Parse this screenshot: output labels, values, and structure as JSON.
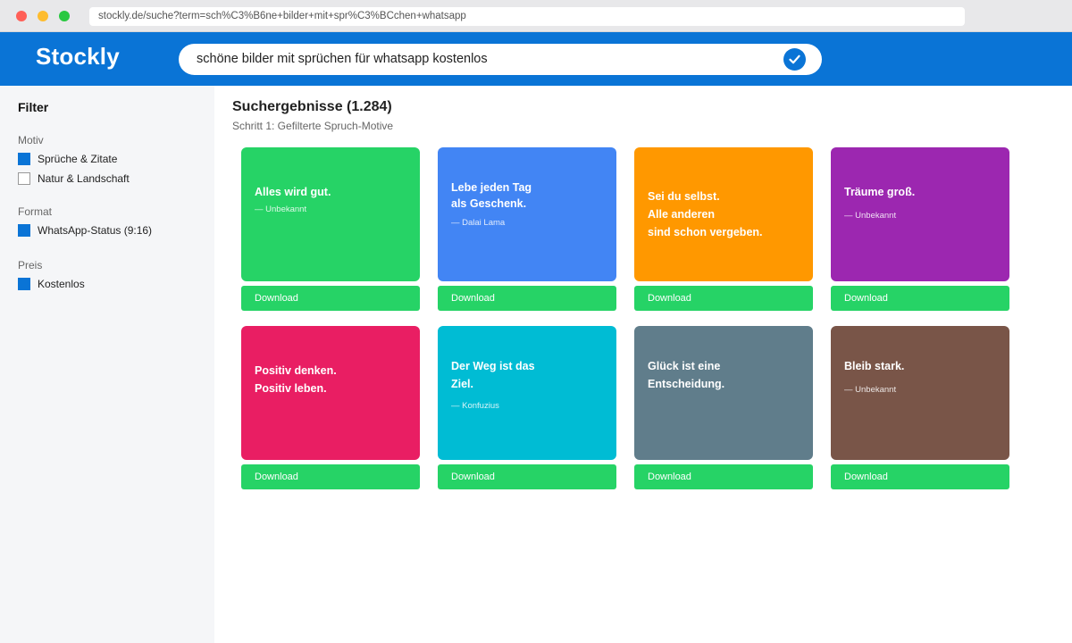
{
  "browser": {
    "url": "stockly.de/suche?term=sch%C3%B6ne+bilder+mit+spr%C3%BCchen+whatsapp"
  },
  "header": {
    "logo": "Stockly",
    "search_value": "schöne bilder mit sprüchen für whatsapp kostenlos",
    "search_icon": "check-circle-icon"
  },
  "sidebar": {
    "title": "Filter",
    "groups": [
      {
        "label": "Motiv",
        "options": [
          {
            "label": "Sprüche & Zitate",
            "checked": true
          },
          {
            "label": "Natur & Landschaft",
            "checked": false
          }
        ]
      },
      {
        "label": "Format",
        "options": [
          {
            "label": "WhatsApp-Status (9:16)",
            "checked": true
          }
        ]
      },
      {
        "label": "Preis",
        "options": [
          {
            "label": "Kostenlos",
            "checked": true
          }
        ]
      }
    ]
  },
  "results": {
    "title": "Suchergebnisse (1.284)",
    "subtitle": "Schritt 1: Gefilterte Spruch-Motive",
    "cards": [
      {
        "quote": "Alles wird gut.",
        "author": "— Unbekannt",
        "color": "#26d366",
        "download": "Download"
      },
      {
        "quote": "Lebe jeden Tag\nals Geschenk.",
        "author": "— Dalai Lama",
        "color": "#4285f4",
        "download": "Download"
      },
      {
        "quote": "Sei du selbst.\nAlle anderen\nsind schon vergeben.",
        "author": "",
        "color": "#ff9800",
        "download": "Download"
      },
      {
        "quote": "Träume groß.",
        "author": "— Unbekannt",
        "color": "#9c27b0",
        "download": "Download"
      },
      {
        "quote": "Positiv denken.\nPositiv leben.",
        "author": "",
        "color": "#e91e63",
        "download": "Download"
      },
      {
        "quote": "Der Weg ist das\nZiel.",
        "author": "— Konfuzius",
        "color": "#00bcd4",
        "download": "Download"
      },
      {
        "quote": "Glück ist eine\nEntscheidung.",
        "author": "",
        "color": "#607d8b",
        "download": "Download"
      },
      {
        "quote": "Bleib stark.",
        "author": "— Unbekannt",
        "color": "#795548",
        "download": "Download"
      }
    ]
  }
}
